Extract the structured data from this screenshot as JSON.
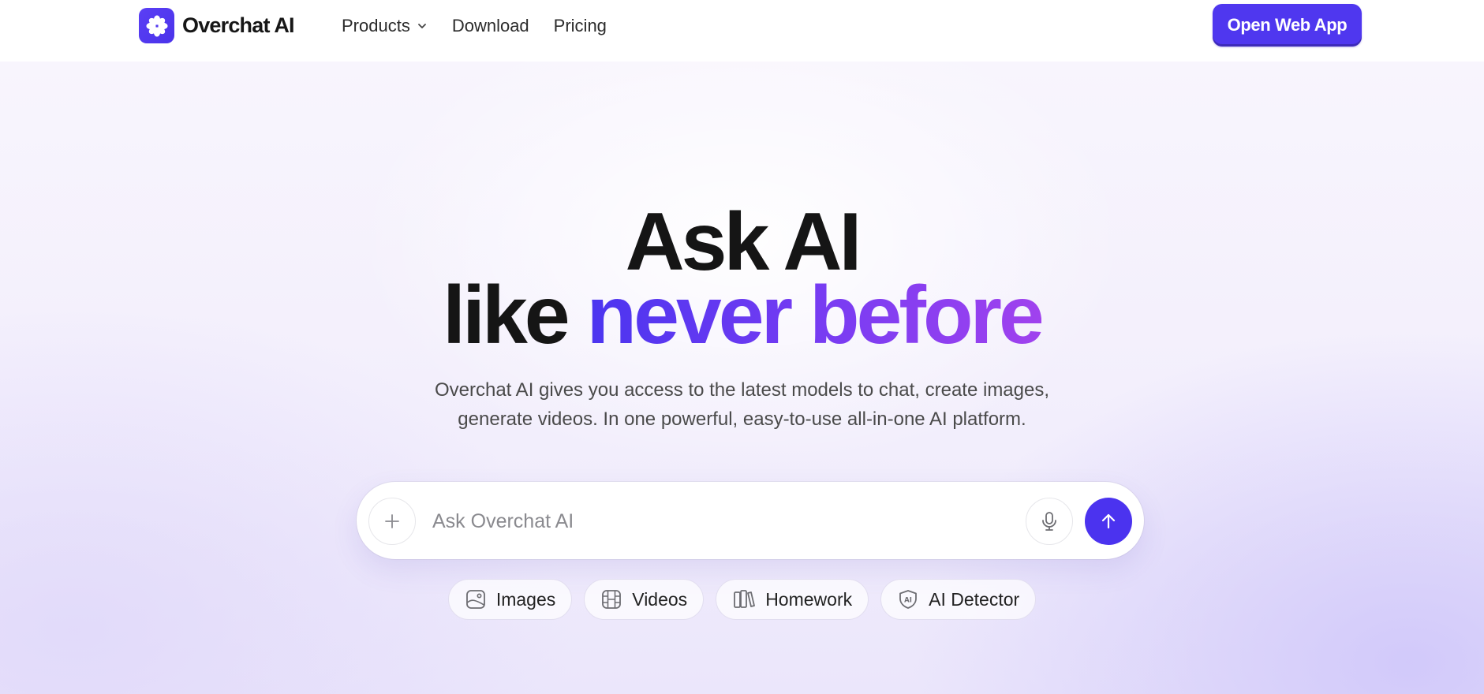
{
  "header": {
    "brand": "Overchat AI",
    "nav": [
      {
        "label": "Products",
        "has_dropdown": true
      },
      {
        "label": "Download"
      },
      {
        "label": "Pricing"
      }
    ],
    "cta_label": "Open Web App"
  },
  "hero": {
    "headline_line1": "Ask AI",
    "headline_line2_plain": "like",
    "headline_line2_accent": "never before",
    "subtitle_line1": "Overchat AI gives you access to the latest models to chat, create images,",
    "subtitle_line2": "generate videos. In one powerful, easy-to-use all-in-one AI platform."
  },
  "prompt": {
    "placeholder": "Ask Overchat AI"
  },
  "chips": [
    {
      "label": "Images",
      "icon": "image-icon"
    },
    {
      "label": "Videos",
      "icon": "film-icon"
    },
    {
      "label": "Homework",
      "icon": "books-icon"
    },
    {
      "label": "AI Detector",
      "icon": "shield-ai-icon"
    }
  ],
  "colors": {
    "brand": "#4f37ef",
    "accent_gradient_start": "#4b35f0",
    "accent_gradient_end": "#a042ee",
    "text_dark": "#151515",
    "text_muted": "#4a4a4a"
  }
}
